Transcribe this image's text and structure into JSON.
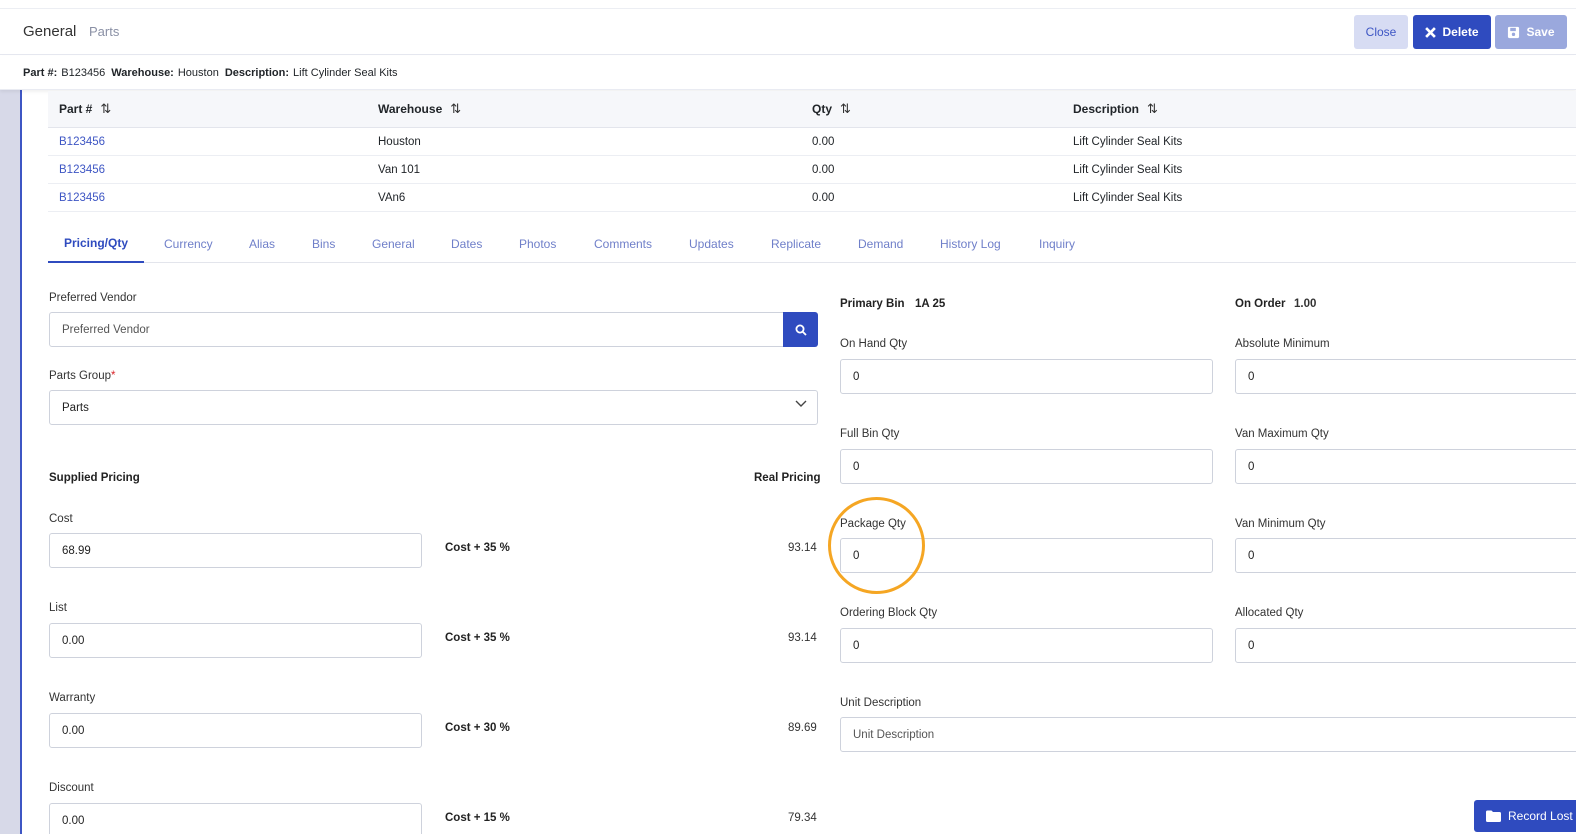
{
  "header": {
    "title": "General",
    "subtitle": "Parts",
    "close_label": "Close",
    "delete_label": "Delete",
    "save_label": "Save"
  },
  "infobar": {
    "part_label": "Part #:",
    "part_value": "B123456",
    "warehouse_label": "Warehouse:",
    "warehouse_value": "Houston",
    "description_label": "Description:",
    "description_value": "Lift Cylinder Seal Kits"
  },
  "table": {
    "columns": [
      "Part #",
      "Warehouse",
      "Qty",
      "Description"
    ],
    "rows": [
      [
        "B123456",
        "Houston",
        "0.00",
        "Lift Cylinder Seal Kits"
      ],
      [
        "B123456",
        "Van 101",
        "0.00",
        "Lift Cylinder Seal Kits"
      ],
      [
        "B123456",
        "VAn6",
        "0.00",
        "Lift Cylinder Seal Kits"
      ]
    ]
  },
  "tabs": [
    "Pricing/Qty",
    "Currency",
    "Alias",
    "Bins",
    "General",
    "Dates",
    "Photos",
    "Comments",
    "Updates",
    "Replicate",
    "Demand",
    "History Log",
    "Inquiry"
  ],
  "left": {
    "preferred_vendor_label": "Preferred Vendor",
    "preferred_vendor_placeholder": "Preferred Vendor",
    "parts_group_label": "Parts Group",
    "parts_group_required": "*",
    "parts_group_value": "Parts",
    "supplied_pricing": "Supplied Pricing",
    "real_pricing": "Real Pricing",
    "pricing": [
      {
        "label": "Cost",
        "value": "68.99",
        "formula": "Cost + 35 %",
        "real": "93.14"
      },
      {
        "label": "List",
        "value": "0.00",
        "formula": "Cost + 35 %",
        "real": "93.14"
      },
      {
        "label": "Warranty",
        "value": "0.00",
        "formula": "Cost + 30 %",
        "real": "89.69"
      },
      {
        "label": "Discount",
        "value": "0.00",
        "formula": "Cost + 15 %",
        "real": "79.34"
      }
    ]
  },
  "right": {
    "primary_bin_label": "Primary Bin",
    "primary_bin_value": "1A 25",
    "on_order_label": "On Order",
    "on_order_value": "1.00",
    "on_hand_label": "On Hand Qty",
    "on_hand_value": "0",
    "absolute_min_label": "Absolute Minimum",
    "absolute_min_value": "0",
    "full_bin_label": "Full Bin Qty",
    "full_bin_value": "0",
    "van_max_label": "Van Maximum Qty",
    "van_max_value": "0",
    "package_label": "Package Qty",
    "package_value": "0",
    "van_min_label": "Van Minimum Qty",
    "van_min_value": "0",
    "ordering_block_label": "Ordering Block Qty",
    "ordering_block_value": "0",
    "allocated_label": "Allocated Qty",
    "allocated_value": "0",
    "unit_desc_label": "Unit Description",
    "unit_desc_placeholder": "Unit Description"
  },
  "record_button": "Record Lost",
  "colors": {
    "accent": "#2f4bbf",
    "highlight": "#f5a623"
  }
}
